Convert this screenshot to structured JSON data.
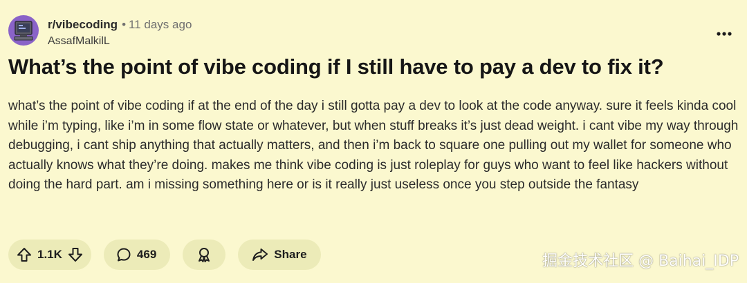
{
  "post": {
    "subreddit": "r/vibecoding",
    "separator": "•",
    "time_ago": "11 days ago",
    "author": "AssafMalkilL",
    "title": "What’s the point of vibe coding if I still have to pay a dev to fix it?",
    "body": "what’s the point of vibe coding if at the end of the day i still gotta pay a dev to look at the code anyway. sure it feels kinda cool while i’m typing, like i’m in some flow state or whatever, but when stuff breaks it’s just dead weight. i cant vibe my way through debugging, i cant ship anything that actually matters, and then i’m back to square one pulling out my wallet for someone who actually knows what they’re doing. makes me think vibe coding is just roleplay for guys who want to feel like hackers without doing the hard part. am i missing something here or is it really just useless once you step outside the fantasy"
  },
  "actions": {
    "votes": "1.1K",
    "comments": "469",
    "share_label": "Share"
  },
  "icons": {
    "more": "more-options-icon",
    "upvote": "upvote-arrow-icon",
    "downvote": "downvote-arrow-icon",
    "comment": "comment-bubble-icon",
    "award": "award-ribbon-icon",
    "share": "share-arrow-icon"
  },
  "watermark": "掘金技术社区 @ Baihai_IDP",
  "colors": {
    "background": "#fbf8cf",
    "pill": "#ecebb8",
    "avatar": "#8a63c8"
  }
}
